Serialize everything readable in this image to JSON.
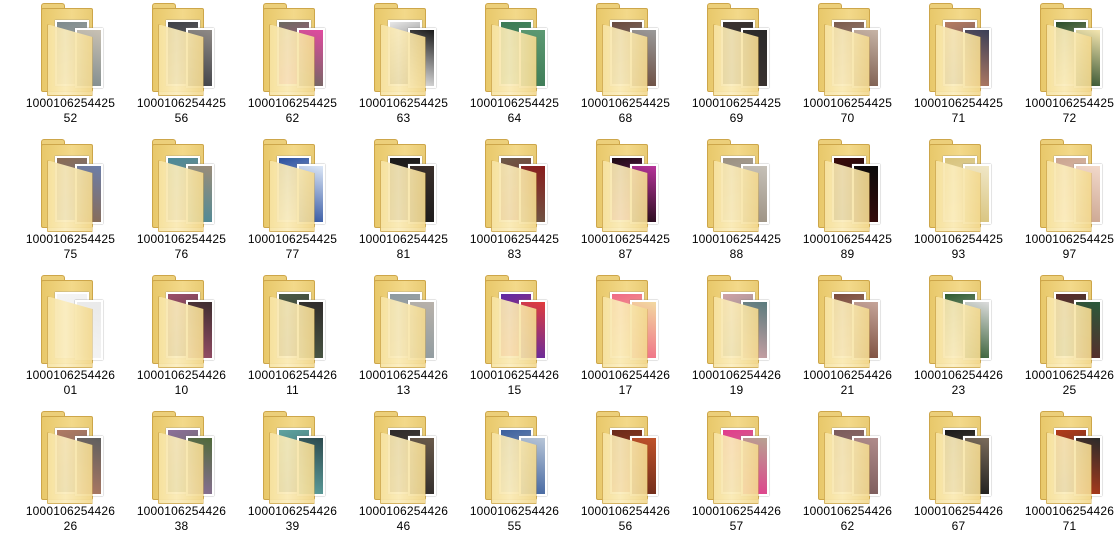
{
  "window": {
    "view": "Large icons"
  },
  "folders": [
    {
      "name_1": "1000106254425",
      "name_2": "52",
      "c1": "#7d8a8d",
      "c2": "#c9c1b3"
    },
    {
      "name_1": "1000106254425",
      "name_2": "56",
      "c1": "#3d3f45",
      "c2": "#8f8a86"
    },
    {
      "name_1": "1000106254425",
      "name_2": "62",
      "c1": "#6b6a5f",
      "c2": "#e14aa0"
    },
    {
      "name_1": "1000106254425",
      "name_2": "63",
      "c1": "#e8e8e8",
      "c2": "#1b1b1b"
    },
    {
      "name_1": "1000106254425",
      "name_2": "64",
      "c1": "#3c7a55",
      "c2": "#5d9a73"
    },
    {
      "name_1": "1000106254425",
      "name_2": "68",
      "c1": "#6a4a3d",
      "c2": "#9a9a9a"
    },
    {
      "name_1": "1000106254425",
      "name_2": "69",
      "c1": "#3b3330",
      "c2": "#2a2a2a"
    },
    {
      "name_1": "1000106254425",
      "name_2": "70",
      "c1": "#7a5a4c",
      "c2": "#c7b4a6"
    },
    {
      "name_1": "1000106254425",
      "name_2": "71",
      "c1": "#b77d62",
      "c2": "#3b3f58"
    },
    {
      "name_1": "1000106254425",
      "name_2": "72",
      "c1": "#2b4c2a",
      "c2": "#f5e6b0"
    },
    {
      "name_1": "1000106254425",
      "name_2": "75",
      "c1": "#8a6b52",
      "c2": "#6c7ea9"
    },
    {
      "name_1": "1000106254425",
      "name_2": "76",
      "c1": "#4a8a99",
      "c2": "#9b8c79"
    },
    {
      "name_1": "1000106254425",
      "name_2": "77",
      "c1": "#2a4f9e",
      "c2": "#dce7f7"
    },
    {
      "name_1": "1000106254425",
      "name_2": "81",
      "c1": "#1a1a1a",
      "c2": "#3a2f2b"
    },
    {
      "name_1": "1000106254425",
      "name_2": "83",
      "c1": "#6c5a48",
      "c2": "#8a1c1c"
    },
    {
      "name_1": "1000106254425",
      "name_2": "87",
      "c1": "#1c0a12",
      "c2": "#b8349b"
    },
    {
      "name_1": "1000106254425",
      "name_2": "88",
      "c1": "#9a8f80",
      "c2": "#c6c1b8"
    },
    {
      "name_1": "1000106254425",
      "name_2": "89",
      "c1": "#3a0b0b",
      "c2": "#0a0a0a"
    },
    {
      "name_1": "1000106254425",
      "name_2": "93",
      "c1": "#d7c27a",
      "c2": "#f0e7c8"
    },
    {
      "name_1": "1000106254425",
      "name_2": "97",
      "c1": "#caa48f",
      "c2": "#f2d9cb"
    },
    {
      "name_1": "1000106254426",
      "name_2": "01",
      "c1": "#f4f4f4",
      "c2": "#e9e9e9"
    },
    {
      "name_1": "1000106254426",
      "name_2": "10",
      "c1": "#9b4f6a",
      "c2": "#3d2d2f"
    },
    {
      "name_1": "1000106254426",
      "name_2": "11",
      "c1": "#4b5a45",
      "c2": "#2f2a2a"
    },
    {
      "name_1": "1000106254426",
      "name_2": "13",
      "c1": "#8d9aa0",
      "c2": "#b9b2aa"
    },
    {
      "name_1": "1000106254426",
      "name_2": "15",
      "c1": "#5d2aa5",
      "c2": "#e23c3c"
    },
    {
      "name_1": "1000106254426",
      "name_2": "17",
      "c1": "#f06a86",
      "c2": "#f2d9a1"
    },
    {
      "name_1": "1000106254426",
      "name_2": "19",
      "c1": "#cfa2a6",
      "c2": "#5a7b7d"
    },
    {
      "name_1": "1000106254426",
      "name_2": "21",
      "c1": "#7a4b3b",
      "c2": "#c6a59a"
    },
    {
      "name_1": "1000106254426",
      "name_2": "23",
      "c1": "#2f5a2f",
      "c2": "#dcdcdc"
    },
    {
      "name_1": "1000106254426",
      "name_2": "25",
      "c1": "#5a2a2a",
      "c2": "#2b5a3b"
    },
    {
      "name_1": "1000106254426",
      "name_2": "26",
      "c1": "#b07a63",
      "c2": "#5f5f5f"
    },
    {
      "name_1": "1000106254426",
      "name_2": "38",
      "c1": "#8c6f9a",
      "c2": "#4f6a3a"
    },
    {
      "name_1": "1000106254426",
      "name_2": "39",
      "c1": "#5fa3a0",
      "c2": "#2d4a4f"
    },
    {
      "name_1": "1000106254426",
      "name_2": "46",
      "c1": "#2d2a2a",
      "c2": "#6a5a4a"
    },
    {
      "name_1": "1000106254426",
      "name_2": "55",
      "c1": "#3b5f9c",
      "c2": "#b8c6d8"
    },
    {
      "name_1": "1000106254426",
      "name_2": "56",
      "c1": "#6a2a1a",
      "c2": "#c0532b"
    },
    {
      "name_1": "1000106254426",
      "name_2": "57",
      "c1": "#e23b8c",
      "c2": "#b7a392"
    },
    {
      "name_1": "1000106254426",
      "name_2": "62",
      "c1": "#7a5a5a",
      "c2": "#b08b8b"
    },
    {
      "name_1": "1000106254426",
      "name_2": "67",
      "c1": "#1a1a1a",
      "c2": "#7b6c5c"
    },
    {
      "name_1": "1000106254426",
      "name_2": "71",
      "c1": "#b33b1a",
      "c2": "#2b2b2b"
    }
  ]
}
